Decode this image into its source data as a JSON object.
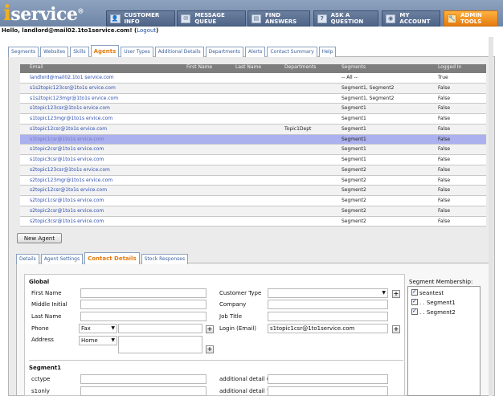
{
  "brand": {
    "logo_i": "i",
    "logo_rest": "service",
    "logo_mark": "®"
  },
  "nav": [
    {
      "label": "CUSTOMER INFO",
      "icon": "customer-icon",
      "glyph": "👤"
    },
    {
      "label": "MESSAGE QUEUE",
      "icon": "message-icon",
      "glyph": "✉"
    },
    {
      "label": "FIND ANSWERS",
      "icon": "book-icon",
      "glyph": "▤"
    },
    {
      "label": "ASK A QUESTION",
      "icon": "question-icon",
      "glyph": "?"
    },
    {
      "label": "MY ACCOUNT",
      "icon": "account-icon",
      "glyph": "◉"
    },
    {
      "label": "ADMIN TOOLS",
      "icon": "tools-icon",
      "glyph": "🔧",
      "active": true
    }
  ],
  "greeting": {
    "text": "Hello, landlord@mail02.1to1service.com!",
    "logout_open": " (",
    "logout": "Logout",
    "logout_close": ")"
  },
  "admin_tabs": [
    "Segments",
    "Websites",
    "Skills",
    "Agents",
    "User Types",
    "Additional Details",
    "Departments",
    "Alerts",
    "Contact Summary",
    "Help"
  ],
  "agents_table": {
    "headers": [
      "Email",
      "First Name",
      "Last Name",
      "Departments",
      "Segments",
      "Logged In"
    ],
    "rows": [
      {
        "email": "landlord@mail02.1to1 service.com",
        "dept": "",
        "segments": "-- All --",
        "logged": "True"
      },
      {
        "email": "s1s2topic123csr@1to1s ervice.com",
        "dept": "",
        "segments": "Segment1, Segment2",
        "logged": "False"
      },
      {
        "email": "s1s2topic123mgr@1to1s ervice.com",
        "dept": "",
        "segments": "Segment1, Segment2",
        "logged": "False"
      },
      {
        "email": "s1topic123csr@1to1s ervice.com",
        "dept": "",
        "segments": "Segment1",
        "logged": "False"
      },
      {
        "email": "s1topic123mgr@1to1s ervice.com",
        "dept": "",
        "segments": "Segment1",
        "logged": "False"
      },
      {
        "email": "s1topic12csr@1to1s ervice.com",
        "dept": "Topic1Dept",
        "segments": "Segment1",
        "logged": "False"
      },
      {
        "email": "s1topic1csr@1to1s ervice.com",
        "dept": "",
        "segments": "Segment1",
        "logged": "False",
        "selected": true
      },
      {
        "email": "s1topic2csr@1to1s ervice.com",
        "dept": "",
        "segments": "Segment1",
        "logged": "False"
      },
      {
        "email": "s1topic3csr@1to1s ervice.com",
        "dept": "",
        "segments": "Segment1",
        "logged": "False"
      },
      {
        "email": "s2topic123csr@1to1s ervice.com",
        "dept": "",
        "segments": "Segment2",
        "logged": "False"
      },
      {
        "email": "s2topic123mgr@1to1s ervice.com",
        "dept": "",
        "segments": "Segment2",
        "logged": "False"
      },
      {
        "email": "s2topic12csr@1to1s ervice.com",
        "dept": "",
        "segments": "Segment2",
        "logged": "False"
      },
      {
        "email": "s2topic1csr@1to1s ervice.com",
        "dept": "",
        "segments": "Segment2",
        "logged": "False"
      },
      {
        "email": "s2topic2csr@1to1s ervice.com",
        "dept": "",
        "segments": "Segment2",
        "logged": "False"
      },
      {
        "email": "s2topic3csr@1to1s ervice.com",
        "dept": "",
        "segments": "Segment2",
        "logged": "False"
      }
    ]
  },
  "new_agent_label": "New Agent",
  "detail_tabs": [
    "Details",
    "Agent Settings",
    "Contact Details",
    "Stock Responses"
  ],
  "form": {
    "global_title": "Global",
    "first_name": "First Name",
    "middle_initial": "Middle Initial",
    "last_name": "Last Name",
    "phone": "Phone",
    "phone_type": "Fax",
    "address": "Address",
    "address_type": "Home",
    "customer_type": "Customer Type",
    "company": "Company",
    "job_title": "Job Title",
    "login": "Login (Email)",
    "login_value": "s1topic1csr@1to1service.com",
    "segment1_title": "Segment1",
    "cctype": "cctype",
    "s1only": "s1only",
    "add6": "additional detail 6",
    "add7": "additional detail 7",
    "plus": "+"
  },
  "segment_membership": {
    "title": "Segment Membership:",
    "items": [
      "seantest",
      ". . Segment1",
      ". . Segment2"
    ]
  }
}
